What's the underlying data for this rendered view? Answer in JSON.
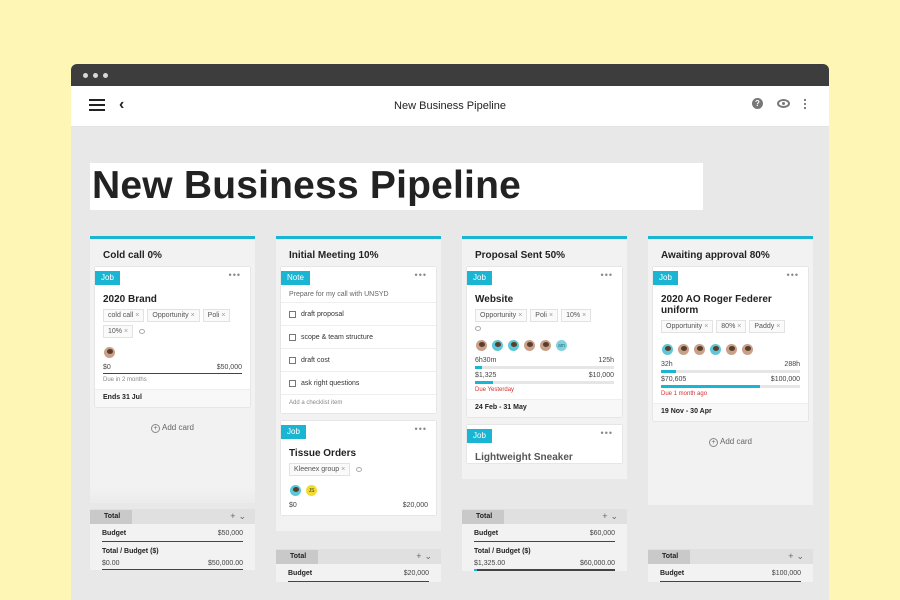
{
  "app": {
    "title": "New Business Pipeline",
    "page_heading": "New Business Pipeline",
    "accent_color": "#19b5d3",
    "icons": [
      "menu-icon",
      "back-icon",
      "help-icon",
      "eye-icon",
      "more-vert-icon"
    ]
  },
  "columns": [
    {
      "title": "Cold call 0%",
      "add_card": "Add card",
      "cards": [
        {
          "tag": "Job",
          "title": "2020 Brand",
          "chips": [
            "cold call",
            "Opportunity",
            "Poli",
            "10%"
          ],
          "budget_left": "$0",
          "budget_right": "$50,000",
          "due": "Due in 2 months",
          "footer": "Ends 31 Jul"
        }
      ],
      "totals": {
        "label": "Total",
        "budget_label": "Budget",
        "budget_value": "$50,000",
        "ratio_label": "Total / Budget ($)",
        "ratio_left": "$0.00",
        "ratio_right": "$50,000.00",
        "ratio_progress": 0
      }
    },
    {
      "title": "Initial Meeting 10%",
      "cards": [
        {
          "tag": "Note",
          "note": "Prepare for my call with UNSYD",
          "checklist": [
            "draft proposal",
            "scope & team structure",
            "draft cost",
            "ask right questions"
          ],
          "add_checklist": "Add a checklist item"
        },
        {
          "tag": "Job",
          "title": "Tissue Orders",
          "chips": [
            "Kleenex group"
          ],
          "avatar_initials": "JS",
          "budget_left": "$0",
          "budget_right": "$20,000"
        }
      ],
      "totals": {
        "label": "Total",
        "budget_label": "Budget",
        "budget_value": "$20,000"
      }
    },
    {
      "title": "Proposal Sent 50%",
      "cards": [
        {
          "tag": "Job",
          "title": "Website",
          "chips": [
            "Opportunity",
            "Poli",
            "10%"
          ],
          "avatar_initials": "am",
          "hours_left": "6h30m",
          "hours_right": "125h",
          "hours_progress": 0.05,
          "budget_left": "$1,325",
          "budget_right": "$10,000",
          "budget_progress": 0.13,
          "due": "Due Yesterday",
          "footer": "24 Feb - 31 May"
        },
        {
          "tag": "Job",
          "title": "Lightweight Sneaker"
        }
      ],
      "totals": {
        "label": "Total",
        "budget_label": "Budget",
        "budget_value": "$60,000",
        "ratio_label": "Total / Budget ($)",
        "ratio_left": "$1,325.00",
        "ratio_right": "$60,000.00",
        "ratio_progress": 0.02
      }
    },
    {
      "title": "Awaiting approval 80%",
      "add_card": "Add card",
      "cards": [
        {
          "tag": "Job",
          "title": "2020 AO Roger Federer uniform",
          "chips": [
            "Opportunity",
            "80%",
            "Paddy"
          ],
          "hours_left": "32h",
          "hours_right": "288h",
          "hours_progress": 0.11,
          "budget_left": "$70,605",
          "budget_right": "$100,000",
          "budget_progress": 0.71,
          "due": "Due 1 month ago",
          "footer": "19 Nov - 30 Apr"
        }
      ],
      "totals": {
        "label": "Total",
        "budget_label": "Budget",
        "budget_value": "$100,000"
      }
    }
  ]
}
